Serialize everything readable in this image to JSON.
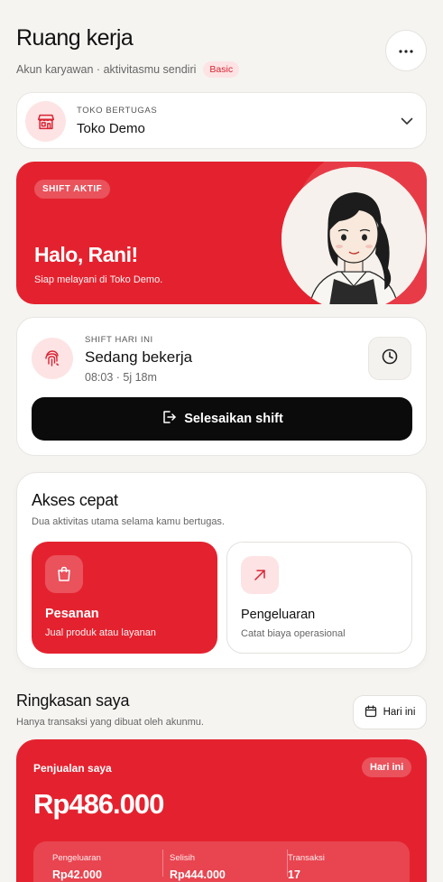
{
  "header": {
    "title": "Ruang kerja",
    "subtitle": "Akun karyawan · aktivitasmu sendiri",
    "plan_badge": "Basic",
    "more_icon": "more-horizontal-icon"
  },
  "store": {
    "label": "TOKO BERTUGAS",
    "name": "Toko Demo",
    "icon": "store-icon"
  },
  "hero": {
    "badge": "SHIFT AKTIF",
    "greeting": "Halo, Rani!",
    "message": "Siap melayani di Toko Demo."
  },
  "shift": {
    "label": "SHIFT HARI INI",
    "status": "Sedang bekerja",
    "time": "08:03 · 5j 18m",
    "end_button": "Selesaikan shift"
  },
  "quick_access": {
    "title": "Akses cepat",
    "subtitle": "Dua aktivitas utama selama kamu bertugas.",
    "tiles": [
      {
        "title": "Pesanan",
        "subtitle": "Jual produk atau layanan",
        "icon": "shopping-bag-icon"
      },
      {
        "title": "Pengeluaran",
        "subtitle": "Catat biaya operasional",
        "icon": "arrow-up-right-icon"
      }
    ]
  },
  "summary": {
    "title": "Ringkasan saya",
    "subtitle": "Hanya transaksi yang dibuat oleh akunmu.",
    "period_button": "Hari ini",
    "sales_label": "Penjualan saya",
    "sales_period": "Hari ini",
    "sales_amount": "Rp486.000",
    "stats": [
      {
        "label": "Pengeluaran",
        "value": "Rp42.000"
      },
      {
        "label": "Selisih",
        "value": "Rp444.000"
      },
      {
        "label": "Transaksi",
        "value": "17"
      }
    ]
  },
  "colors": {
    "brand_red": "#e4222f",
    "soft_red": "#fde3e4",
    "dark": "#0b0b0b",
    "background": "#f5f4f1"
  }
}
